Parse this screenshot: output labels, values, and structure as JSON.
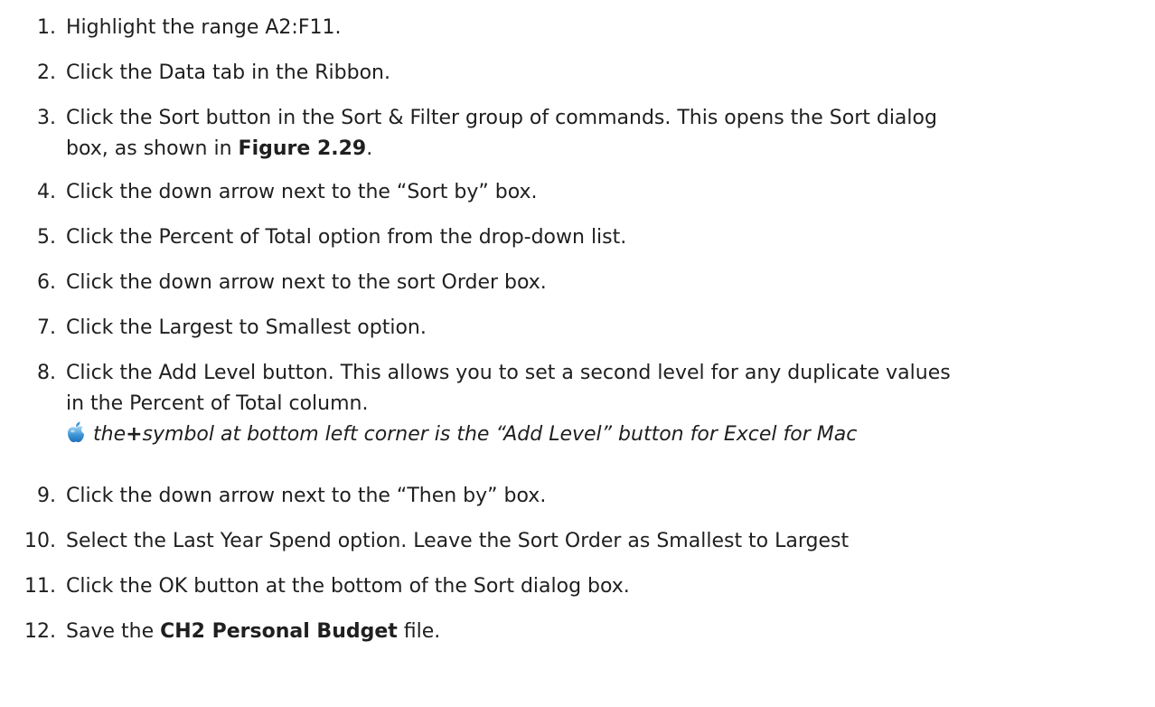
{
  "steps": [
    {
      "num": "1.",
      "text": "Highlight the range A2:F11."
    },
    {
      "num": "2.",
      "text": "Click the Data tab in the Ribbon."
    },
    {
      "num": "3.",
      "line1": "Click the Sort button in the Sort & Filter group of commands. This opens the Sort dialog",
      "line2_pre": "box, as shown in ",
      "line2_bold": "Figure 2.29",
      "line2_post": "."
    },
    {
      "num": "4.",
      "text": "Click the down arrow next to the “Sort by” box."
    },
    {
      "num": "5.",
      "text": "Click the Percent of Total option from the drop-down list."
    },
    {
      "num": "6.",
      "text": "Click the down arrow next to the sort Order box."
    },
    {
      "num": "7.",
      "text": "Click the Largest to Smallest option."
    },
    {
      "num": "8.",
      "line1": "Click the Add Level button. This allows you to set a second level for any duplicate values",
      "line2": "in the Percent of Total column.",
      "mac_note_pre": "the ",
      "mac_note_bold": "+",
      "mac_note_post": " symbol at bottom left corner is the “Add Level” button for Excel for Mac",
      "mac_icon": "apple-icon"
    },
    {
      "num": "9.",
      "text": "Click the down arrow next to the “Then by” box."
    },
    {
      "num": "10.",
      "text": "Select the Last Year Spend option. Leave the Sort Order as Smallest to Largest"
    },
    {
      "num": "11.",
      "text": "Click the OK button at the bottom of the Sort dialog box."
    },
    {
      "num": "12.",
      "text_pre": "Save the ",
      "text_bold": "CH2 Personal Budget",
      "text_post": " file."
    }
  ]
}
